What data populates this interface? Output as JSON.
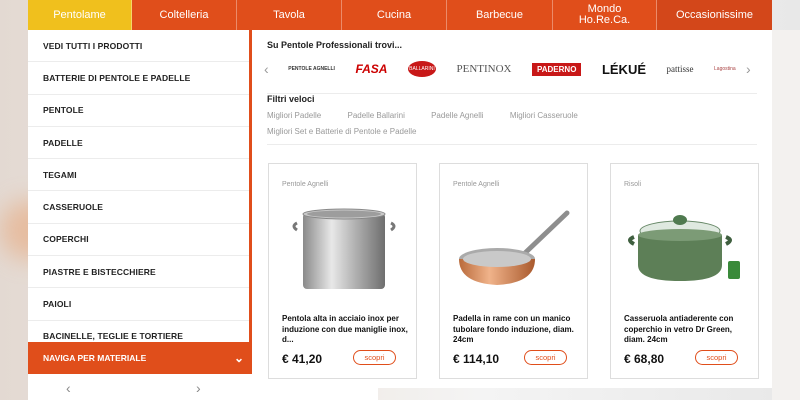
{
  "topnav": [
    {
      "label": "Pentolame"
    },
    {
      "label": "Coltelleria"
    },
    {
      "label": "Tavola"
    },
    {
      "label": "Cucina"
    },
    {
      "label": "Barbecue"
    },
    {
      "label": "Mondo Ho.Re.Ca."
    },
    {
      "label": "Occasionissime"
    }
  ],
  "sidebar": {
    "items": [
      {
        "label": "VEDI TUTTI I PRODOTTI"
      },
      {
        "label": "BATTERIE DI PENTOLE E PADELLE"
      },
      {
        "label": "PENTOLE"
      },
      {
        "label": "PADELLE"
      },
      {
        "label": "TEGAMI"
      },
      {
        "label": "CASSERUOLE"
      },
      {
        "label": "COPERCHI"
      },
      {
        "label": "PIASTRE E BISTECCHIERE"
      },
      {
        "label": "PAIOLI"
      },
      {
        "label": "BACINELLE, TEGLIE E TORTIERE"
      }
    ],
    "naviga_label": "NAVIGA PER MATERIALE"
  },
  "brands": {
    "title": "Su Pentole Professionali trovi...",
    "logos": [
      {
        "name": "PENTOLE AGNELLI",
        "icon": "agnelli-logo"
      },
      {
        "name": "FASA",
        "icon": "fasa-logo"
      },
      {
        "name": "BALLARINI",
        "icon": "ballarini-logo"
      },
      {
        "name": "PENTINOX",
        "icon": "pentinox-logo"
      },
      {
        "name": "PADERNO",
        "icon": "paderno-logo"
      },
      {
        "name": "LÉKUÉ",
        "icon": "lekue-logo"
      },
      {
        "name": "pattisse",
        "icon": "pattisse-logo"
      },
      {
        "name": "Lagostina",
        "icon": "lagostina-logo"
      }
    ]
  },
  "filtri": {
    "title": "Filtri veloci",
    "items": [
      {
        "label": "Migliori Padelle"
      },
      {
        "label": "Padelle Ballarini"
      },
      {
        "label": "Padelle Agnelli"
      },
      {
        "label": "Migliori Casseruole"
      },
      {
        "label": "Migliori Set e Batterie di Pentole e Padelle"
      }
    ]
  },
  "products": [
    {
      "brand": "Pentole Agnelli",
      "name": "Pentola alta in acciaio inox per induzione con due maniglie inox, d...",
      "price": "€ 41,20",
      "cta": "scopri",
      "icon": "stockpot-image"
    },
    {
      "brand": "Pentole Agnelli",
      "name": "Padella in rame con un manico tubolare fondo induzione, diam. 24cm",
      "price": "€ 114,10",
      "cta": "scopri",
      "icon": "copper-pan-image"
    },
    {
      "brand": "Risoli",
      "name": "Casseruola antiaderente con coperchio in vetro Dr Green, diam. 24cm",
      "price": "€ 68,80",
      "cta": "scopri",
      "icon": "green-casserole-image"
    }
  ],
  "colors": {
    "accent": "#e04e1b",
    "active_tab": "#f0c01d"
  }
}
